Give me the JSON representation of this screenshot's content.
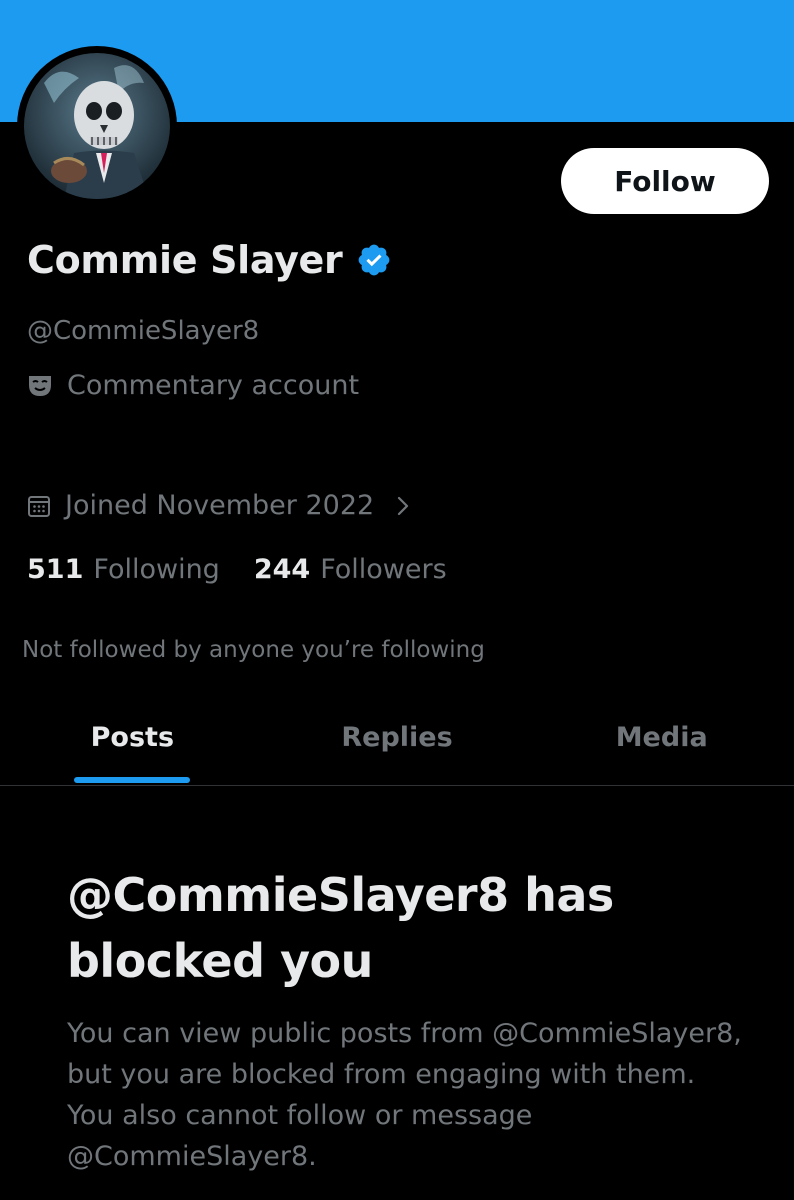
{
  "profile": {
    "follow_label": "Follow",
    "display_name": "Commie Slayer",
    "handle": "@CommieSlayer8",
    "account_label": "Commentary account",
    "joined": "Joined November 2022",
    "following_count": "511",
    "following_label": "Following",
    "followers_count": "244",
    "followers_label": "Followers",
    "not_followed_note": "Not followed by anyone you’re following"
  },
  "tabs": [
    {
      "label": "Posts",
      "active": true
    },
    {
      "label": "Replies",
      "active": false
    },
    {
      "label": "Media",
      "active": false
    }
  ],
  "blocked": {
    "title": "@CommieSlayer8 has blocked you",
    "body": "You can view public posts from @CommieSlayer8, but you are blocked from engaging with them. You also cannot follow or message @CommieSlayer8."
  },
  "icons": {
    "verified": "verified-badge-icon",
    "label": "theater-mask-icon",
    "joined": "calendar-icon",
    "more": "chevron-right-icon"
  },
  "colors": {
    "accent": "#1d9bf0",
    "background": "#000000",
    "primary_text": "#e7e9ea",
    "secondary_text": "#71767b",
    "divider": "#2f3336"
  }
}
